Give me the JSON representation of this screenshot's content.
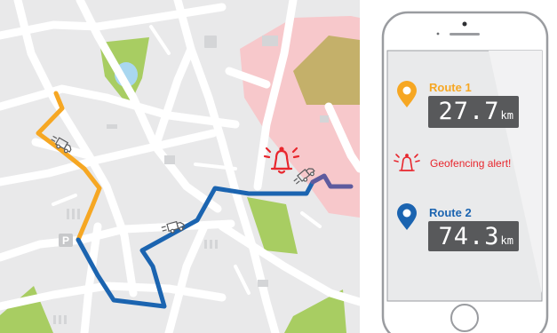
{
  "colors": {
    "map_background": "#e9e9ea",
    "road": "#ffffff",
    "park": "#a8cd62",
    "water": "#a9d7f0",
    "geofence_zone": "#f7c8cb",
    "geofence_inner": "#c4b06a",
    "route1": "#f6a723",
    "route2": "#1b64b0",
    "route_overlap": "#5e5b9e",
    "alert": "#e8262d",
    "phone_outline": "#9a9ca0",
    "phone_screen": "#e9eaeb",
    "display": "#58595b"
  },
  "map": {
    "parking_label": "P",
    "geofence_alert_icon": "alarm-bell-icon",
    "vehicle_icon": "delivery-truck-icon"
  },
  "phone": {
    "routes": [
      {
        "label": "Route 1",
        "distance": "27.7",
        "unit": "km",
        "color": "#f6a723",
        "icon": "location-pin-icon"
      },
      {
        "label": "Route 2",
        "distance": "74.3",
        "unit": "km",
        "color": "#1b64b0",
        "icon": "location-pin-icon"
      }
    ],
    "alert": {
      "text": "Geofencing alert!",
      "color": "#e8262d",
      "icon": "alarm-bell-icon"
    }
  }
}
